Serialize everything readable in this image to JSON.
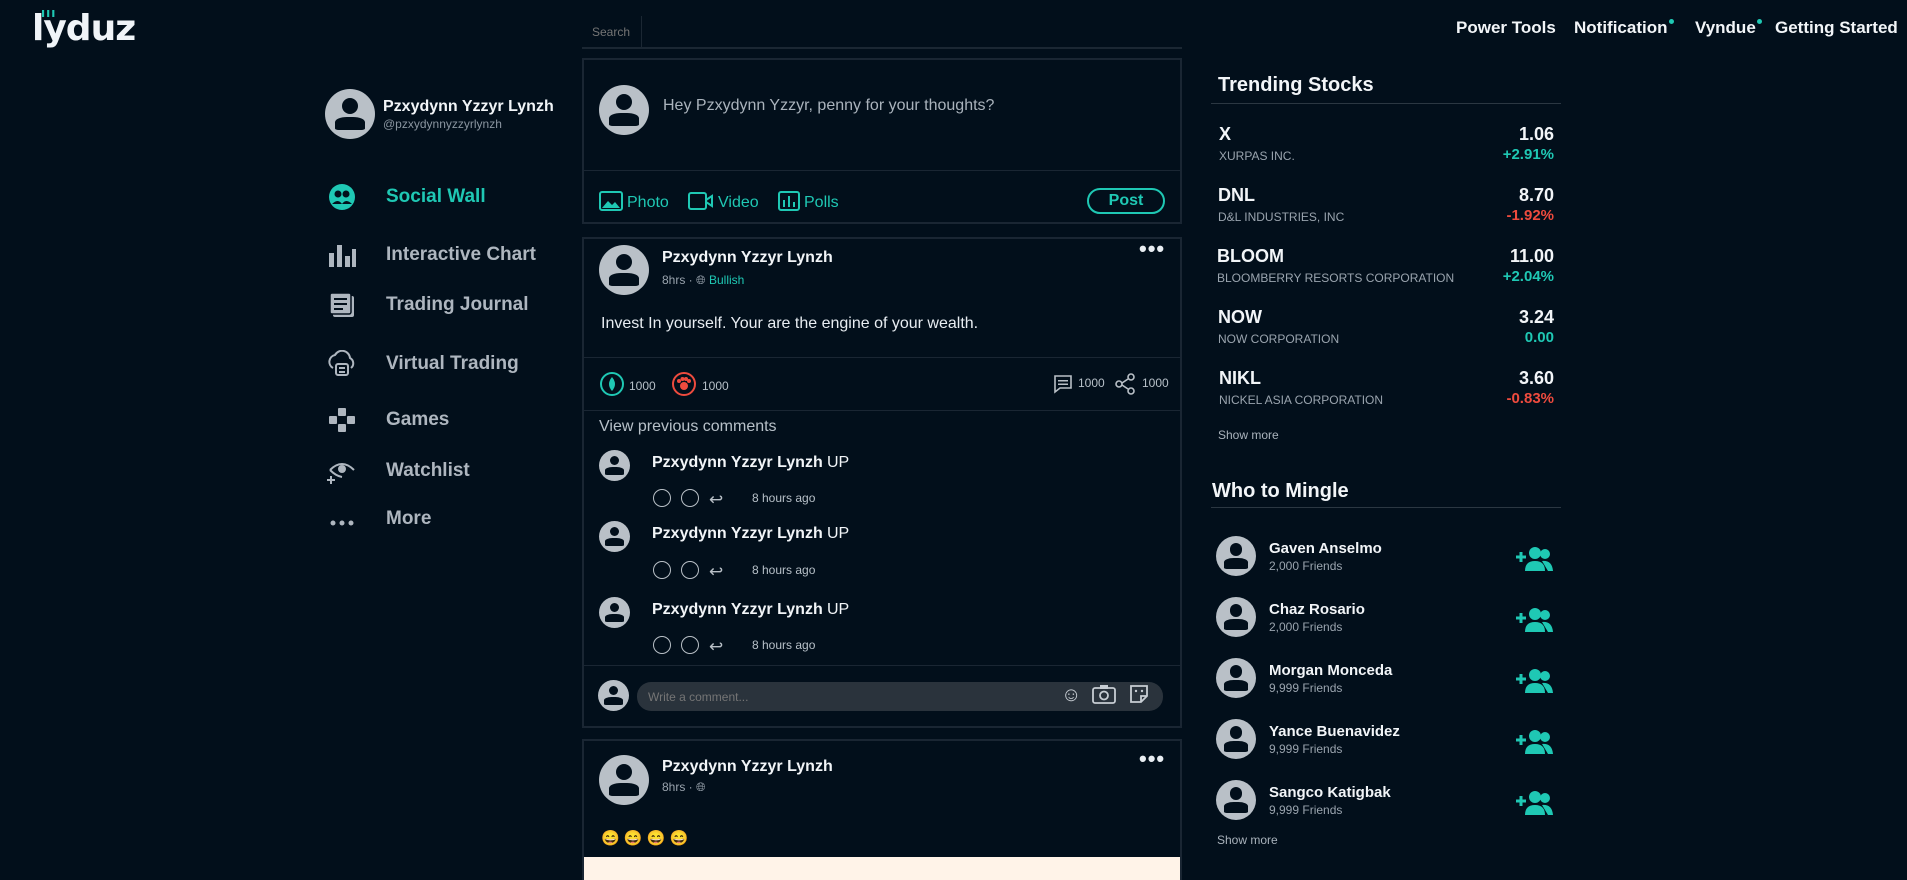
{
  "header": {
    "logo": "lyduz",
    "search_placeholder": "Search",
    "nav": [
      {
        "label": "Power Tools",
        "dot": false
      },
      {
        "label": "Notification",
        "dot": true
      },
      {
        "label": "Vyndue",
        "dot": true
      },
      {
        "label": "Getting Started",
        "dot": false
      }
    ]
  },
  "profile": {
    "name": "Pzxydynn Yzzyr Lynzh",
    "handle": "@pzxydynnyzzyrlynzh"
  },
  "sidebar": {
    "items": [
      {
        "label": "Social Wall",
        "icon": "social-wall-icon",
        "active": true
      },
      {
        "label": "Interactive Chart",
        "icon": "bar-chart-icon",
        "active": false
      },
      {
        "label": "Trading Journal",
        "icon": "journal-icon",
        "active": false
      },
      {
        "label": "Virtual Trading",
        "icon": "virtual-trading-icon",
        "active": false
      },
      {
        "label": "Games",
        "icon": "gamepad-icon",
        "active": false
      },
      {
        "label": "Watchlist",
        "icon": "watchlist-eye-icon",
        "active": false
      },
      {
        "label": "More",
        "icon": "more-dots-icon",
        "active": false
      }
    ]
  },
  "composer": {
    "placeholder": "Hey Pzxydynn Yzzyr, penny for your thoughts?",
    "photo": "Photo",
    "video": "Video",
    "polls": "Polls",
    "post": "Post"
  },
  "post1": {
    "author": "Pzxydynn Yzzyr Lynzh",
    "time": "8hrs",
    "sentiment": "Bullish",
    "body": "Invest In yourself. Your are the engine of your wealth.",
    "bull_count": "1000",
    "bear_count": "1000",
    "comment_count": "1000",
    "share_count": "1000",
    "view_previous": "View previous comments",
    "comments": [
      {
        "author": "Pzxydynn Yzzyr Lynzh",
        "text": "UP",
        "time": "8 hours ago"
      },
      {
        "author": "Pzxydynn Yzzyr Lynzh",
        "text": "UP",
        "time": "8 hours ago"
      },
      {
        "author": "Pzxydynn Yzzyr Lynzh",
        "text": "UP",
        "time": "8 hours ago"
      }
    ],
    "comment_placeholder": "Write a comment..."
  },
  "post2": {
    "author": "Pzxydynn Yzzyr Lynzh",
    "time": "8hrs",
    "body": "😄 😄 😄 😄"
  },
  "trending": {
    "title": "Trending Stocks",
    "stocks": [
      {
        "symbol": "X",
        "name": "XURPAS INC.",
        "price": "1.06",
        "change": "+2.91%",
        "dir": "up"
      },
      {
        "symbol": "DNL",
        "name": "D&L INDUSTRIES, INC",
        "price": "8.70",
        "change": "-1.92%",
        "dir": "down"
      },
      {
        "symbol": "BLOOM",
        "name": "BLOOMBERRY RESORTS CORPORATION",
        "price": "11.00",
        "change": "+2.04%",
        "dir": "up"
      },
      {
        "symbol": "NOW",
        "name": "NOW CORPORATION",
        "price": "3.24",
        "change": "0.00",
        "dir": "up"
      },
      {
        "symbol": "NIKL",
        "name": "NICKEL ASIA CORPORATION",
        "price": "3.60",
        "change": "-0.83%",
        "dir": "down"
      }
    ],
    "show_more": "Show more"
  },
  "mingle": {
    "title": "Who to Mingle",
    "people": [
      {
        "name": "Gaven Anselmo",
        "friends": "2,000 Friends"
      },
      {
        "name": "Chaz Rosario",
        "friends": "2,000 Friends"
      },
      {
        "name": "Morgan Monceda",
        "friends": "9,999 Friends"
      },
      {
        "name": "Yance Buenavidez",
        "friends": "9,999 Friends"
      },
      {
        "name": "Sangco Katigbak",
        "friends": "9,999 Friends"
      }
    ],
    "show_more": "Show more"
  },
  "colors": {
    "background": "#020f1b",
    "accent": "#1fc8b4",
    "negative": "#ee4b3e",
    "border": "#1a2633"
  }
}
